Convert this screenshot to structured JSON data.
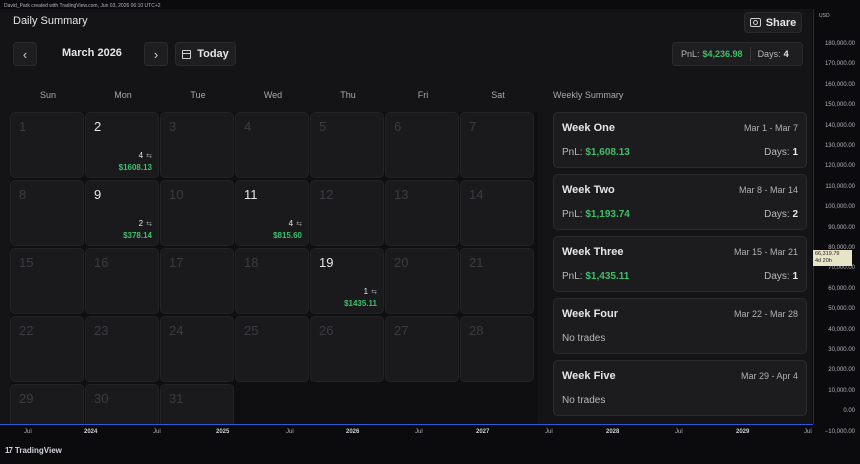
{
  "header_line": "David_Park created with TradingView.com, Jun 03, 2026 06:10 UTC+2",
  "title": "Daily Summary",
  "share_label": "Share",
  "month": "March 2026",
  "today_label": "Today",
  "summary": {
    "pnl_label": "PnL:",
    "pnl_value": "$4,236.98",
    "days_label": "Days:",
    "days_value": "4"
  },
  "weekdays": [
    "Sun",
    "Mon",
    "Tue",
    "Wed",
    "Thu",
    "Fri",
    "Sat"
  ],
  "weekly_title": "Weekly Summary",
  "days": [
    {
      "d": "1"
    },
    {
      "d": "2",
      "trades": "4",
      "pnl": "$1608.13"
    },
    {
      "d": "3"
    },
    {
      "d": "4"
    },
    {
      "d": "5"
    },
    {
      "d": "6"
    },
    {
      "d": "7"
    },
    {
      "d": "8"
    },
    {
      "d": "9",
      "trades": "2",
      "pnl": "$378.14"
    },
    {
      "d": "10"
    },
    {
      "d": "11",
      "trades": "4",
      "pnl": "$815.60"
    },
    {
      "d": "12"
    },
    {
      "d": "13"
    },
    {
      "d": "14"
    },
    {
      "d": "15"
    },
    {
      "d": "16"
    },
    {
      "d": "17"
    },
    {
      "d": "18"
    },
    {
      "d": "19",
      "trades": "1",
      "pnl": "$1435.11"
    },
    {
      "d": "20"
    },
    {
      "d": "21"
    },
    {
      "d": "22"
    },
    {
      "d": "23"
    },
    {
      "d": "24"
    },
    {
      "d": "25"
    },
    {
      "d": "26"
    },
    {
      "d": "27"
    },
    {
      "d": "28"
    },
    {
      "d": "29"
    },
    {
      "d": "30"
    },
    {
      "d": "31"
    }
  ],
  "weeks": [
    {
      "name": "Week One",
      "range": "Mar 1 - Mar 7",
      "pnl_label": "PnL:",
      "pnl": "$1,608.13",
      "days_label": "Days:",
      "days": "1"
    },
    {
      "name": "Week Two",
      "range": "Mar 8 - Mar 14",
      "pnl_label": "PnL:",
      "pnl": "$1,193.74",
      "days_label": "Days:",
      "days": "2"
    },
    {
      "name": "Week Three",
      "range": "Mar 15 - Mar 21",
      "pnl_label": "PnL:",
      "pnl": "$1,435.11",
      "days_label": "Days:",
      "days": "1"
    },
    {
      "name": "Week Four",
      "range": "Mar 22 - Mar 28",
      "none": "No trades"
    },
    {
      "name": "Week Five",
      "range": "Mar 29 - Apr 4",
      "none": "No trades"
    }
  ],
  "price_axis": {
    "currency": "USD",
    "ticks": [
      "180,000.00",
      "170,000.00",
      "160,000.00",
      "150,000.00",
      "140,000.00",
      "130,000.00",
      "120,000.00",
      "110,000.00",
      "100,000.00",
      "90,000.00",
      "80,000.00",
      "70,000.00",
      "60,000.00",
      "50,000.00",
      "40,000.00",
      "30,000.00",
      "20,000.00",
      "10,000.00",
      "0.00",
      "−10,000.00"
    ],
    "last_price": "66,319.79",
    "countdown": "4d 20h"
  },
  "time_axis": [
    {
      "label": "Jul",
      "bold": false
    },
    {
      "label": "2024",
      "bold": true
    },
    {
      "label": "Jul",
      "bold": false
    },
    {
      "label": "2025",
      "bold": true
    },
    {
      "label": "Jul",
      "bold": false
    },
    {
      "label": "2026",
      "bold": true
    },
    {
      "label": "Jul",
      "bold": false
    },
    {
      "label": "2027",
      "bold": true
    },
    {
      "label": "Jul",
      "bold": false
    },
    {
      "label": "2028",
      "bold": true
    },
    {
      "label": "Jul",
      "bold": false
    },
    {
      "label": "2029",
      "bold": true
    },
    {
      "label": "Jul",
      "bold": false
    }
  ],
  "footer_brand": "TradingView",
  "footer_mark": "17"
}
